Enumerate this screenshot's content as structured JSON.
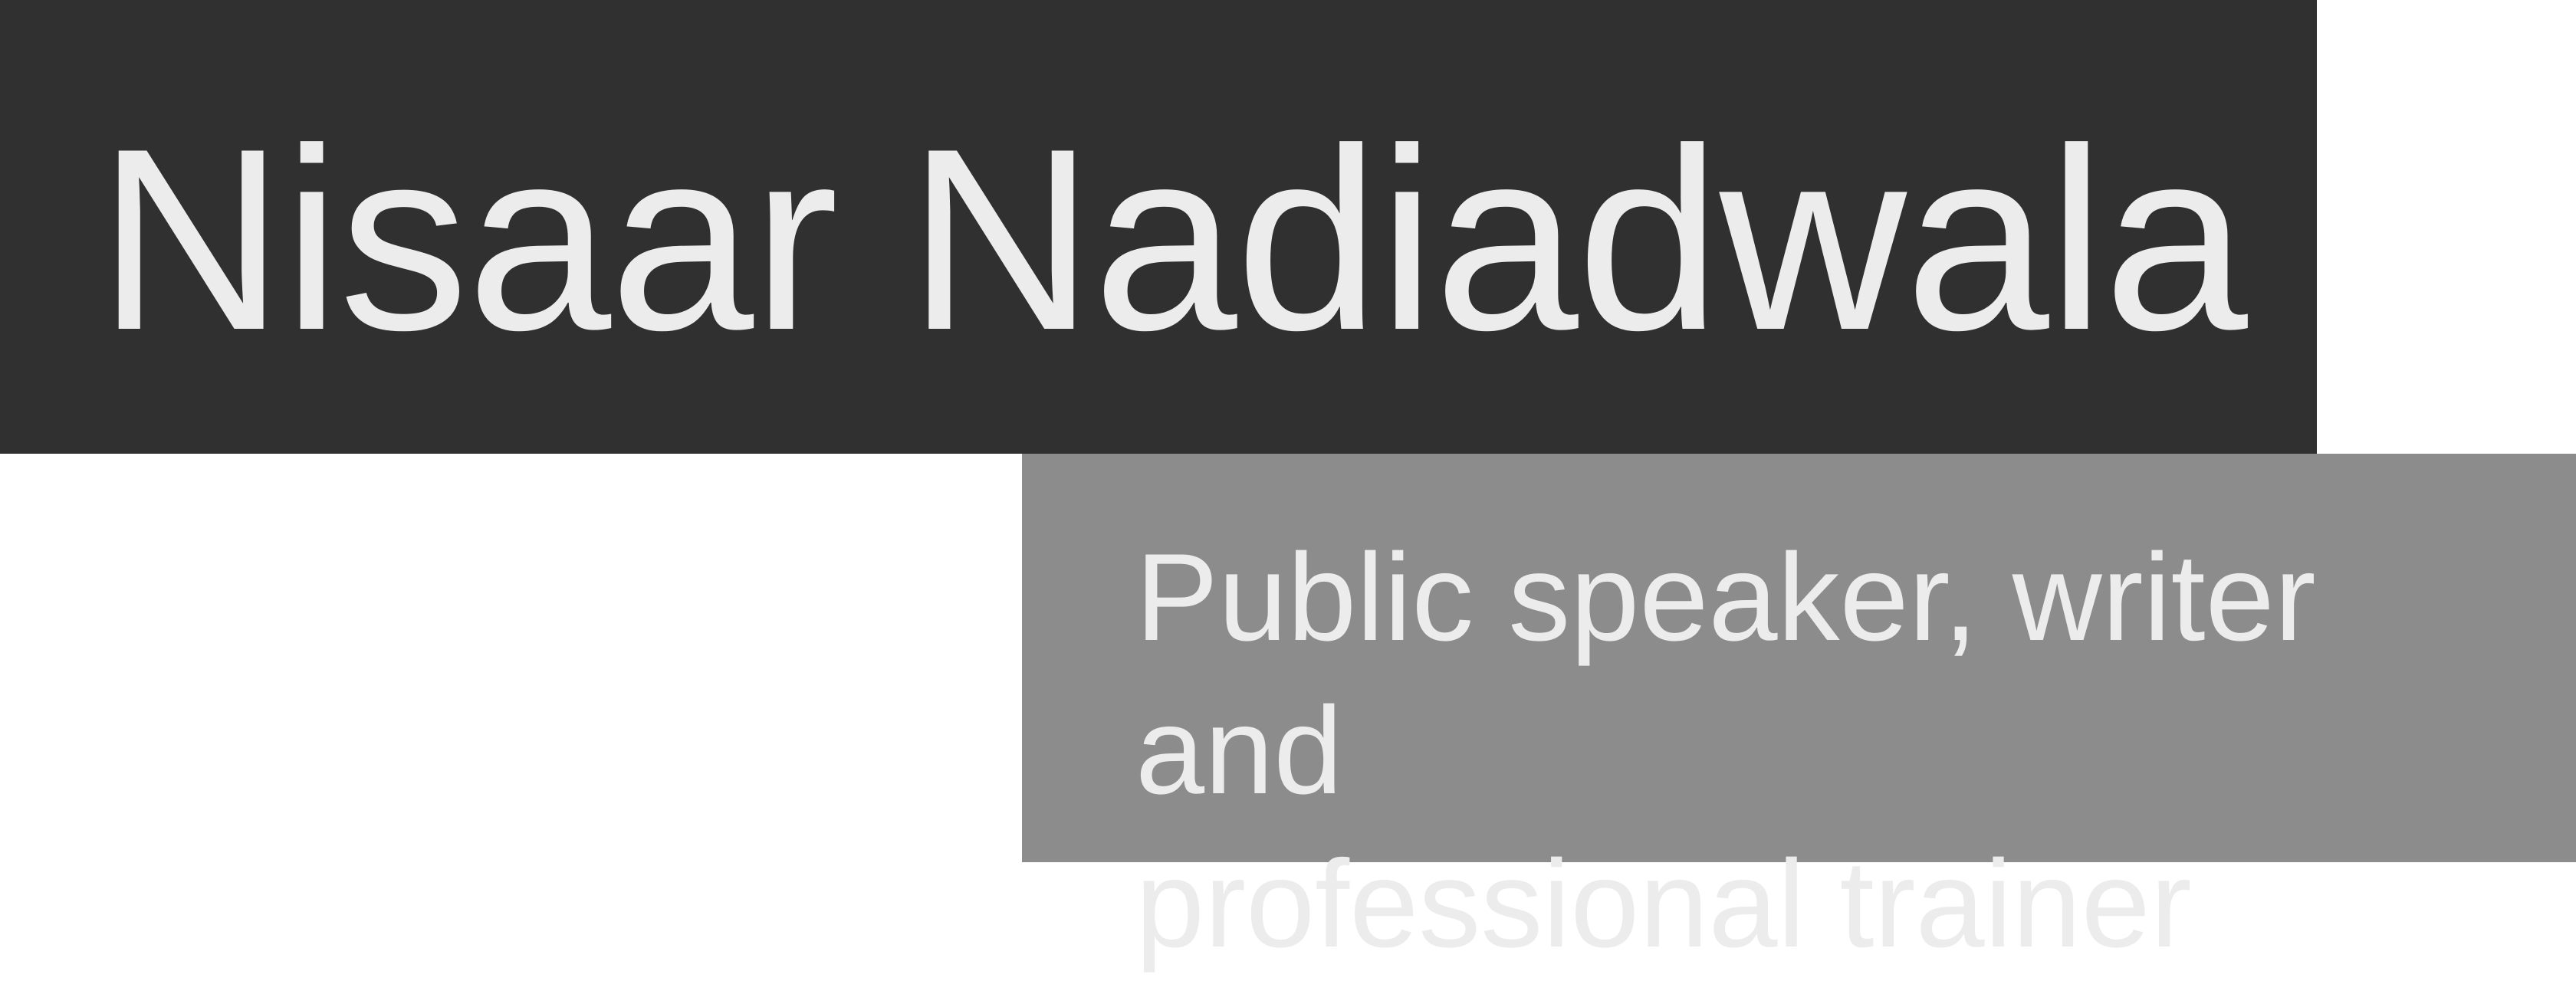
{
  "header": {
    "name": "Nisaar Nadiadwala"
  },
  "tagline": {
    "line1": "Public speaker, writer and",
    "line2": "professional trainer"
  },
  "colors": {
    "name_background": "#303030",
    "tagline_background": "#8c8c8c",
    "text": "#ececec",
    "page_background": "#ffffff"
  }
}
